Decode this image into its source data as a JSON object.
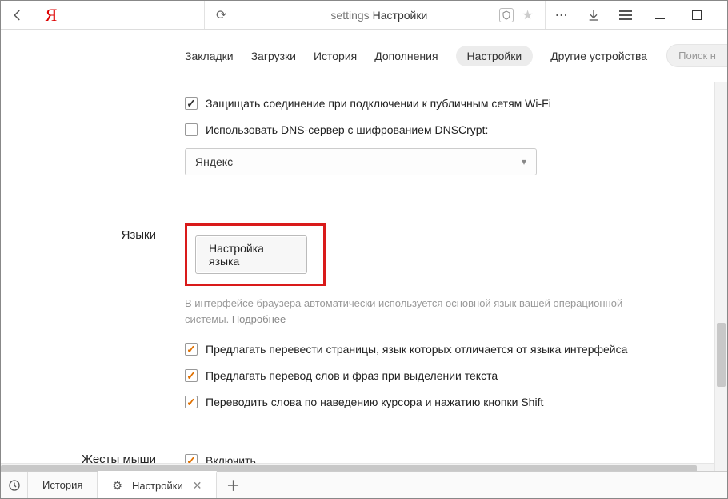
{
  "titlebar": {
    "logo": "Я",
    "tab_url_small": "settings",
    "tab_title": "Настройки"
  },
  "nav": {
    "tabs": [
      "Закладки",
      "Загрузки",
      "История",
      "Дополнения",
      "Настройки",
      "Другие устройства"
    ],
    "active_index": 4,
    "search_placeholder": "Поиск н"
  },
  "security": {
    "protect_wifi": "Защищать соединение при подключении к публичным сетям Wi-Fi",
    "dns_crypt": "Использовать DNS-сервер с шифрованием DNSCrypt:",
    "dns_provider": "Яндекс"
  },
  "languages": {
    "section_label": "Языки",
    "button": "Настройка языка",
    "hint_text": "В интерфейсе браузера автоматически используется основной язык вашей операционной системы. ",
    "hint_link": "Подробнее",
    "opt_translate_pages": "Предлагать перевести страницы, язык которых отличается от языка интерфейса",
    "opt_translate_selection": "Предлагать перевод слов и фраз при выделении текста",
    "opt_translate_hover": "Переводить слова по наведению курсора и нажатию кнопки Shift"
  },
  "mouse": {
    "section_label": "Жесты мыши",
    "enable": "Включить"
  },
  "statusbar": {
    "history": "История",
    "settings": "Настройки"
  }
}
